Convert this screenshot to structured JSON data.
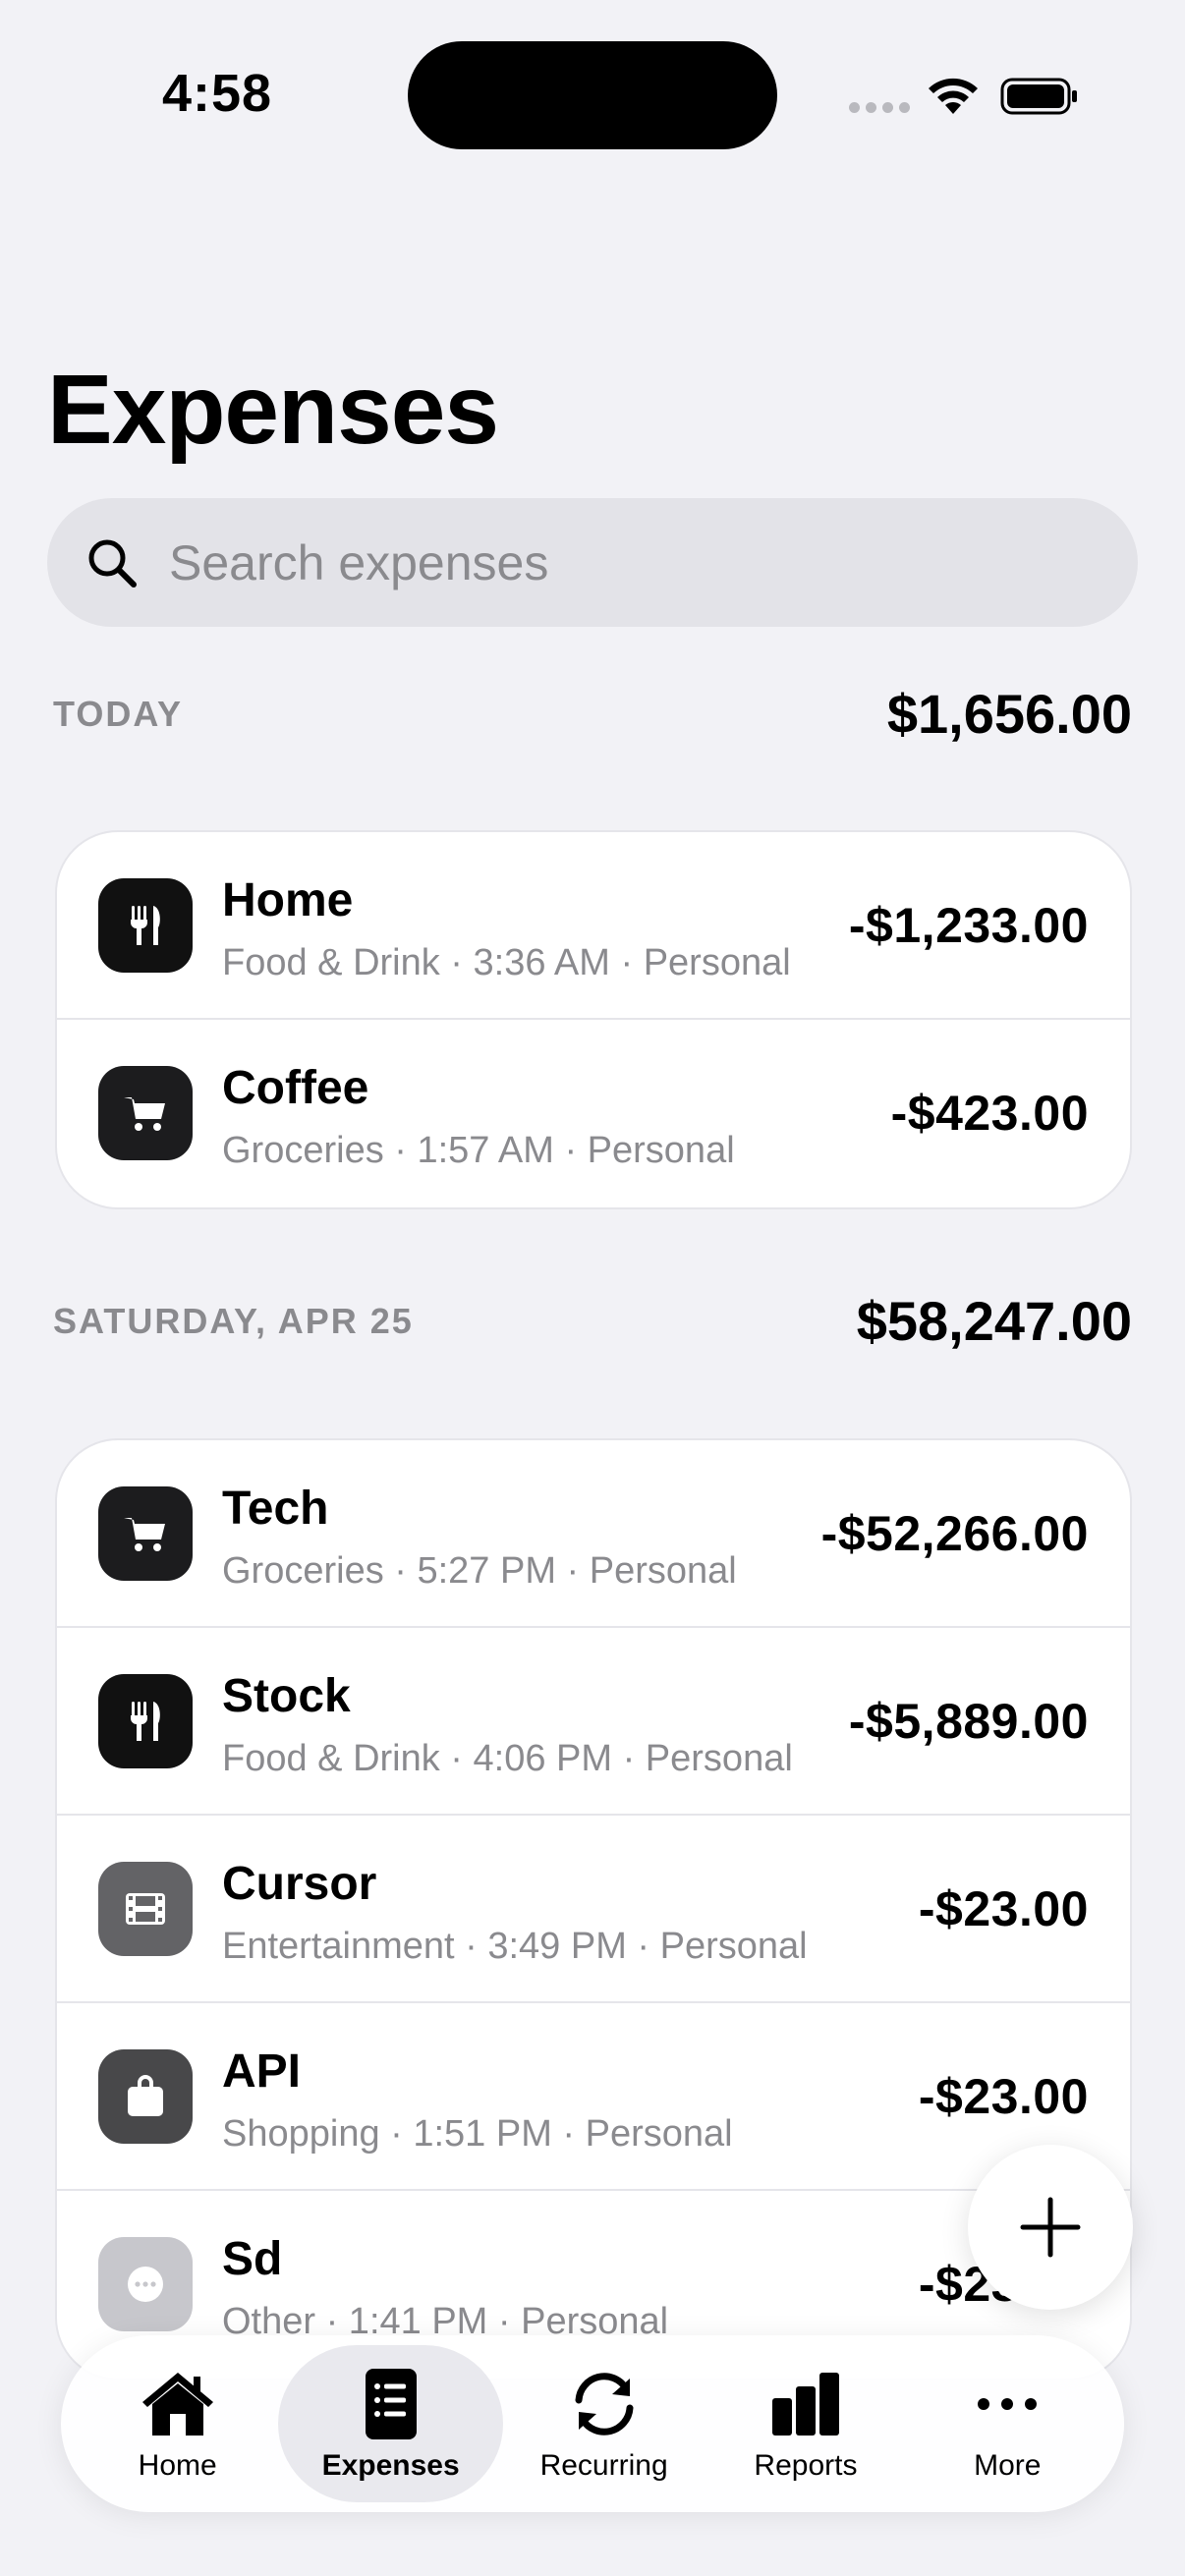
{
  "status": {
    "time": "4:58"
  },
  "header": {
    "title": "Expenses"
  },
  "search": {
    "placeholder": "Search expenses"
  },
  "sections": [
    {
      "label": "TODAY",
      "total": "$1,656.00",
      "items": [
        {
          "title": "Home",
          "subtitle": "Food & Drink · 3:36 AM · Personal",
          "amount": "-$1,233.00",
          "icon": "fork-knife-icon"
        },
        {
          "title": "Coffee",
          "subtitle": "Groceries · 1:57 AM · Personal",
          "amount": "-$423.00",
          "icon": "cart-icon"
        }
      ]
    },
    {
      "label": "SATURDAY, APR 25",
      "total": "$58,247.00",
      "items": [
        {
          "title": "Tech",
          "subtitle": "Groceries · 5:27 PM · Personal",
          "amount": "-$52,266.00",
          "icon": "cart-icon"
        },
        {
          "title": "Stock",
          "subtitle": "Food & Drink · 4:06 PM · Personal",
          "amount": "-$5,889.00",
          "icon": "fork-knife-icon"
        },
        {
          "title": "Cursor",
          "subtitle": "Entertainment · 3:49 PM · Personal",
          "amount": "-$23.00",
          "icon": "film-icon"
        },
        {
          "title": "API",
          "subtitle": "Shopping · 1:51 PM · Personal",
          "amount": "-$23.00",
          "icon": "bag-icon"
        },
        {
          "title": "Sd",
          "subtitle": "Other · 1:41 PM · Personal",
          "amount": "-$23.00",
          "icon": "ellipsis-icon"
        }
      ]
    }
  ],
  "tabs": [
    {
      "label": "Home",
      "icon": "house-icon",
      "active": false
    },
    {
      "label": "Expenses",
      "icon": "list-icon",
      "active": true
    },
    {
      "label": "Recurring",
      "icon": "repeat-icon",
      "active": false
    },
    {
      "label": "Reports",
      "icon": "chart-icon",
      "active": false
    },
    {
      "label": "More",
      "icon": "more-icon",
      "active": false
    }
  ],
  "colors": {
    "background": "#F2F2F6",
    "icon_dark": "#111111",
    "icon_gray": "#636366",
    "icon_light": "#C7C7CC",
    "secondary_text": "#8A8A8E"
  }
}
